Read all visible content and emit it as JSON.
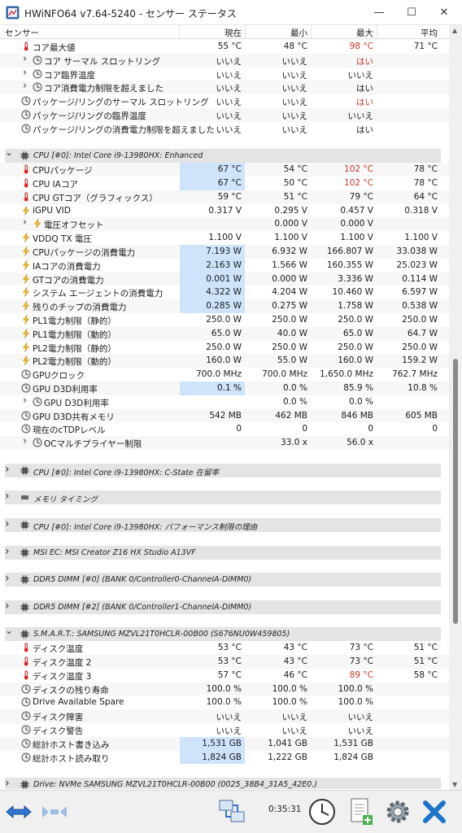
{
  "window": {
    "title": "HWiNFO64 v7.64-5240 - センサー ステータス",
    "min": "—",
    "max": "☐",
    "close": "✕"
  },
  "columns": {
    "sensor": "センサー",
    "current": "現在",
    "min": "最小",
    "max": "最大",
    "avg": "平均"
  },
  "rows": [
    {
      "label": "コア最大値",
      "cur": "55 °C",
      "min": "48 °C",
      "max": "98 °C",
      "avg": "71 °C",
      "maxRed": true,
      "icon": "thermometer-icon",
      "indent": 1
    },
    {
      "label": "コア サーマル スロットリング",
      "cur": "いいえ",
      "min": "いいえ",
      "max": "はい",
      "avg": "",
      "maxRed": true,
      "icon": "clock-icon",
      "indent": 1,
      "chev": true
    },
    {
      "label": "コア臨界温度",
      "cur": "いいえ",
      "min": "いいえ",
      "max": "いいえ",
      "avg": "",
      "icon": "clock-icon",
      "indent": 1,
      "chev": true
    },
    {
      "label": "コア消費電力制限を超えました",
      "cur": "いいえ",
      "min": "いいえ",
      "max": "はい",
      "avg": "",
      "icon": "clock-icon",
      "indent": 1,
      "chev": true
    },
    {
      "label": "パッケージ/リングのサーマル スロットリング",
      "cur": "いいえ",
      "min": "いいえ",
      "max": "はい",
      "avg": "",
      "maxRed": true,
      "icon": "clock-icon",
      "indent": 1
    },
    {
      "label": "パッケージ/リングの臨界温度",
      "cur": "いいえ",
      "min": "いいえ",
      "max": "いいえ",
      "avg": "",
      "icon": "clock-icon",
      "indent": 1
    },
    {
      "label": "パッケージ/リングの消費電力制限を超えました",
      "cur": "いいえ",
      "min": "いいえ",
      "max": "はい",
      "avg": "",
      "icon": "clock-icon",
      "indent": 1
    },
    {
      "blank": true
    },
    {
      "group": true,
      "label": "CPU [#0]: Intel Core i9-13980HX: Enhanced",
      "open": true
    },
    {
      "label": "CPUパッケージ",
      "cur": "67 °C",
      "min": "54 °C",
      "max": "102 °C",
      "avg": "78 °C",
      "maxRed": true,
      "icon": "thermometer-icon",
      "hl": true
    },
    {
      "label": "CPU IAコア",
      "cur": "67 °C",
      "min": "50 °C",
      "max": "102 °C",
      "avg": "78 °C",
      "maxRed": true,
      "icon": "thermometer-icon",
      "hl": true
    },
    {
      "label": "CPU GTコア（グラフィックス）",
      "cur": "59 °C",
      "min": "51 °C",
      "max": "79 °C",
      "avg": "64 °C",
      "icon": "thermometer-icon"
    },
    {
      "label": "iGPU VID",
      "cur": "0.317 V",
      "min": "0.295 V",
      "max": "0.457 V",
      "avg": "0.318 V",
      "icon": "lightning-icon"
    },
    {
      "label": "電圧オフセット",
      "cur": "",
      "min": "0.000 V",
      "max": "0.000 V",
      "avg": "",
      "icon": "lightning-icon",
      "chev": true,
      "indent": 1
    },
    {
      "label": "VDDQ TX 電圧",
      "cur": "1.100 V",
      "min": "1.100 V",
      "max": "1.100 V",
      "avg": "1.100 V",
      "icon": "lightning-icon"
    },
    {
      "label": "CPUパッケージの消費電力",
      "cur": "7.193 W",
      "min": "6.932 W",
      "max": "166.807 W",
      "avg": "33.038 W",
      "icon": "lightning-icon",
      "hl": true
    },
    {
      "label": "IAコアの消費電力",
      "cur": "2.163 W",
      "min": "1.566 W",
      "max": "160.355 W",
      "avg": "25.023 W",
      "icon": "lightning-icon",
      "hl": true
    },
    {
      "label": "GTコアの消費電力",
      "cur": "0.001 W",
      "min": "0.000 W",
      "max": "3.336 W",
      "avg": "0.114 W",
      "icon": "lightning-icon",
      "hl": true
    },
    {
      "label": "システム エージェントの消費電力",
      "cur": "4.322 W",
      "min": "4.204 W",
      "max": "10.460 W",
      "avg": "6.597 W",
      "icon": "lightning-icon",
      "hl": true
    },
    {
      "label": "残りのチップの消費電力",
      "cur": "0.285 W",
      "min": "0.275 W",
      "max": "1.758 W",
      "avg": "0.538 W",
      "icon": "lightning-icon",
      "hl": true
    },
    {
      "label": "PL1電力制限（静的）",
      "cur": "250.0 W",
      "min": "250.0 W",
      "max": "250.0 W",
      "avg": "250.0 W",
      "icon": "lightning-icon"
    },
    {
      "label": "PL1電力制限（動的）",
      "cur": "65.0 W",
      "min": "40.0 W",
      "max": "65.0 W",
      "avg": "64.7 W",
      "icon": "lightning-icon"
    },
    {
      "label": "PL2電力制限（静的）",
      "cur": "250.0 W",
      "min": "250.0 W",
      "max": "250.0 W",
      "avg": "250.0 W",
      "icon": "lightning-icon"
    },
    {
      "label": "PL2電力制限（動的）",
      "cur": "160.0 W",
      "min": "55.0 W",
      "max": "160.0 W",
      "avg": "159.2 W",
      "icon": "lightning-icon"
    },
    {
      "label": "GPUクロック",
      "cur": "700.0 MHz",
      "min": "700.0 MHz",
      "max": "1,650.0 MHz",
      "avg": "762.7 MHz",
      "icon": "clock-icon"
    },
    {
      "label": "GPU D3D利用率",
      "cur": "0.1 %",
      "min": "0.0 %",
      "max": "85.9 %",
      "avg": "10.8 %",
      "icon": "clock-icon",
      "hl": true
    },
    {
      "label": "GPU D3D利用率",
      "cur": "",
      "min": "0.0 %",
      "max": "0.0 %",
      "avg": "",
      "icon": "clock-icon",
      "chev": true,
      "indent": 1
    },
    {
      "label": "GPU D3D共有メモリ",
      "cur": "542 MB",
      "min": "462 MB",
      "max": "846 MB",
      "avg": "605 MB",
      "icon": "clock-icon"
    },
    {
      "label": "現在のcTDPレベル",
      "cur": "0",
      "min": "0",
      "max": "0",
      "avg": "0",
      "icon": "clock-icon"
    },
    {
      "label": "OCマルチプライヤー制限",
      "cur": "",
      "min": "33.0 x",
      "max": "56.0 x",
      "avg": "",
      "icon": "clock-icon",
      "chev": true,
      "indent": 1
    },
    {
      "blank": true
    },
    {
      "group": true,
      "label": "CPU [#0]: Intel Core i9-13980HX: C-State 在留率",
      "open": false
    },
    {
      "blank": true
    },
    {
      "group": true,
      "label": "メモリ タイミング",
      "open": false,
      "noicon": true
    },
    {
      "blank": true
    },
    {
      "group": true,
      "label": "CPU [#0]: Intel Core i9-13980HX: パフォーマンス制限の理由",
      "open": false
    },
    {
      "blank": true
    },
    {
      "group": true,
      "label": "MSI EC: MSI Creator Z16 HX Studio A13VF",
      "open": false
    },
    {
      "blank": true
    },
    {
      "group": true,
      "label": "DDR5 DIMM [#0] (BANK 0/Controller0-ChannelA-DIMM0)",
      "open": false
    },
    {
      "blank": true
    },
    {
      "group": true,
      "label": "DDR5 DIMM [#2] (BANK 0/Controller1-ChannelA-DIMM0)",
      "open": false
    },
    {
      "blank": true
    },
    {
      "group": true,
      "label": "S.M.A.R.T.: SAMSUNG MZVL21T0HCLR-00B00 (S676NU0W459805)",
      "open": true
    },
    {
      "label": "ディスク温度",
      "cur": "53 °C",
      "min": "43 °C",
      "max": "73 °C",
      "avg": "51 °C",
      "icon": "thermometer-icon"
    },
    {
      "label": "ディスク温度 2",
      "cur": "53 °C",
      "min": "43 °C",
      "max": "73 °C",
      "avg": "51 °C",
      "icon": "thermometer-icon"
    },
    {
      "label": "ディスク温度 3",
      "cur": "57 °C",
      "min": "46 °C",
      "max": "89 °C",
      "avg": "58 °C",
      "maxRed": true,
      "icon": "thermometer-icon"
    },
    {
      "label": "ディスクの残り寿命",
      "cur": "100.0 %",
      "min": "100.0 %",
      "max": "100.0 %",
      "avg": "",
      "icon": "clock-icon"
    },
    {
      "label": "Drive Available Spare",
      "cur": "100.0 %",
      "min": "100.0 %",
      "max": "100.0 %",
      "avg": "",
      "icon": "clock-icon"
    },
    {
      "label": "ディスク障害",
      "cur": "いいえ",
      "min": "いいえ",
      "max": "いいえ",
      "avg": "",
      "icon": "clock-icon"
    },
    {
      "label": "ディスク警告",
      "cur": "いいえ",
      "min": "いいえ",
      "max": "いいえ",
      "avg": "",
      "icon": "clock-icon"
    },
    {
      "label": "総計ホスト書き込み",
      "cur": "1,531 GB",
      "min": "1,041 GB",
      "max": "1,531 GB",
      "avg": "",
      "icon": "clock-icon",
      "hl": true
    },
    {
      "label": "総計ホスト読み取り",
      "cur": "1,824 GB",
      "min": "1,222 GB",
      "max": "1,824 GB",
      "avg": "",
      "icon": "clock-icon",
      "hl": true
    },
    {
      "blank": true
    },
    {
      "group": true,
      "label": "Drive: NVMe SAMSUNG MZVL21T0HCLR-00B00 (0025_38B4_31A5_42E0.)",
      "open": false
    }
  ],
  "toolbar": {
    "elapsed": "0:35:31"
  },
  "colors": {
    "highlight": "#cfe3fb",
    "red": "#c0392b",
    "group": "#e4e4e4"
  }
}
